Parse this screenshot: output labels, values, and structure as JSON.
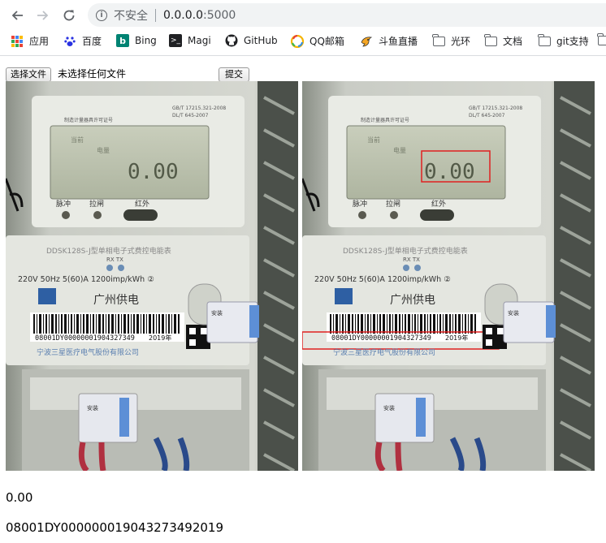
{
  "browser": {
    "security_label": "不安全",
    "url_host": "0.0.0.0",
    "url_port": ":5000"
  },
  "bookmarks": [
    {
      "label": "应用",
      "icon": "apps-grid-icon"
    },
    {
      "label": "百度",
      "icon": "baidu-paw-icon"
    },
    {
      "label": "Bing",
      "icon": "bing-icon"
    },
    {
      "label": "Magi",
      "icon": "magi-icon"
    },
    {
      "label": "GitHub",
      "icon": "github-icon"
    },
    {
      "label": "QQ邮箱",
      "icon": "qq-mail-icon"
    },
    {
      "label": "斗鱼直播",
      "icon": "douyu-icon"
    },
    {
      "label": "光环",
      "icon": "folder-icon"
    },
    {
      "label": "文档",
      "icon": "folder-icon"
    },
    {
      "label": "git支持",
      "icon": "folder-icon"
    }
  ],
  "form": {
    "choose_file_label": "选择文件",
    "no_file_text": "未选择任何文件",
    "submit_label": "提交"
  },
  "meter": {
    "cert_label": "制造计量器具许可证号",
    "standard_line1": "GB/T 17215.321-2008",
    "standard_line2": "DL/T 645-2007",
    "lcd_label1": "当前",
    "lcd_label2": "电量",
    "lcd_reading": "0.00",
    "indicator_labels": [
      "脉冲",
      "拉闸",
      "红外"
    ],
    "model_title": "DDSK128S-J型单相电子式费控电能表",
    "rx_tx": "RX  TX",
    "spec_line": "220V  50Hz  5(60)A  1200imp/kWh ②",
    "utility_name": "广州供电",
    "barcode_number": "08001DY00000001904327349",
    "barcode_year": "2019年",
    "manufacturer": "宁波三星医疗电气股份有限公司",
    "seal_text": "安装",
    "seal_code": "08001FE00000  00193107966S"
  },
  "results": {
    "reading": "0.00",
    "barcode": "08001DY00000001904327349201​9"
  }
}
